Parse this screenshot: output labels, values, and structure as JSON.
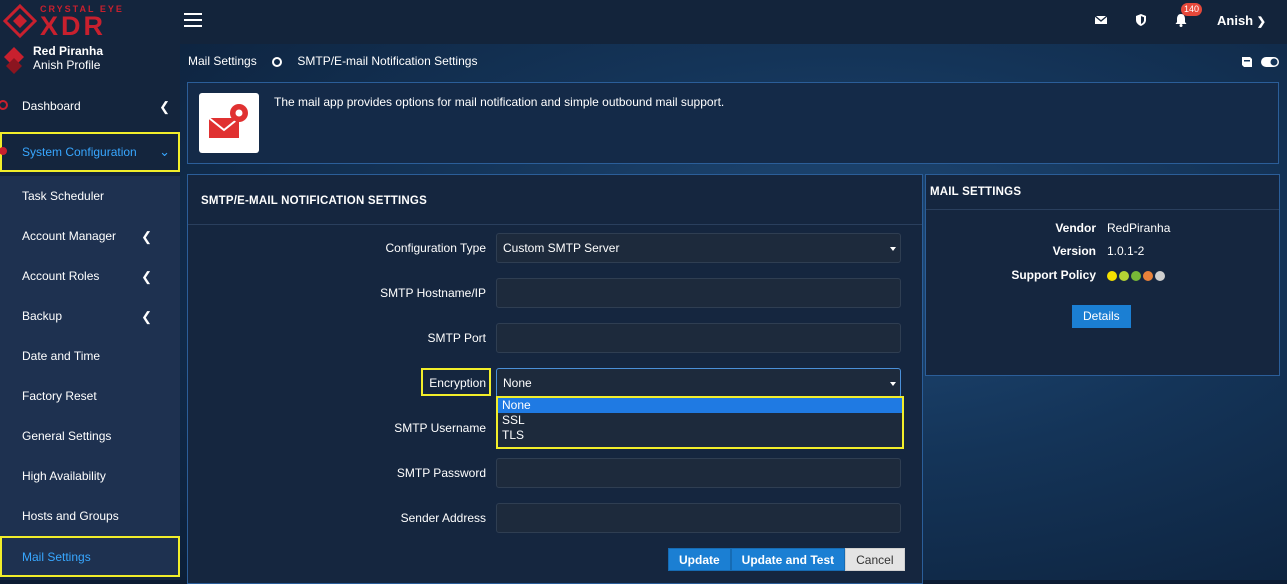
{
  "brand": {
    "name": "CRYSTAL EYE",
    "product": "XDR"
  },
  "profile": {
    "org": "Red Piranha",
    "user": "Anish Profile"
  },
  "sidebar": {
    "items": [
      {
        "label": "Dashboard"
      },
      {
        "label": "System Configuration"
      },
      {
        "label": "Task Scheduler"
      },
      {
        "label": "Account Manager"
      },
      {
        "label": "Account Roles"
      },
      {
        "label": "Backup"
      },
      {
        "label": "Date and Time"
      },
      {
        "label": "Factory Reset"
      },
      {
        "label": "General Settings"
      },
      {
        "label": "High Availability"
      },
      {
        "label": "Hosts and Groups"
      },
      {
        "label": "Mail Settings"
      }
    ]
  },
  "header": {
    "notification_count": "140",
    "user": "Anish"
  },
  "breadcrumb": {
    "parent": "Mail Settings",
    "current": "SMTP/E-mail Notification Settings"
  },
  "info": {
    "text": "The mail app provides options for mail notification and simple outbound mail support."
  },
  "smtp": {
    "title": "SMTP/E-MAIL NOTIFICATION SETTINGS",
    "config_type_label": "Configuration Type",
    "config_type_value": "Custom SMTP Server",
    "hostname_label": "SMTP Hostname/IP",
    "port_label": "SMTP Port",
    "encryption_label": "Encryption",
    "encryption_value": "None",
    "encryption_options": [
      "None",
      "SSL",
      "TLS"
    ],
    "username_label": "SMTP Username",
    "password_label": "SMTP Password",
    "sender_label": "Sender Address",
    "buttons": {
      "update": "Update",
      "update_test": "Update and Test",
      "cancel": "Cancel"
    }
  },
  "mail": {
    "title": "MAIL SETTINGS",
    "vendor_label": "Vendor",
    "vendor_value": "RedPiranha",
    "version_label": "Version",
    "version_value": "1.0.1-2",
    "support_label": "Support Policy",
    "support_dots": [
      "#f5e000",
      "#b5d334",
      "#78b837",
      "#e8823a",
      "#cfcfcf"
    ],
    "details_label": "Details"
  },
  "colors": {
    "accent": "#1b7fd3",
    "highlight": "#f2ee2a",
    "brand_red": "#c8202e"
  }
}
